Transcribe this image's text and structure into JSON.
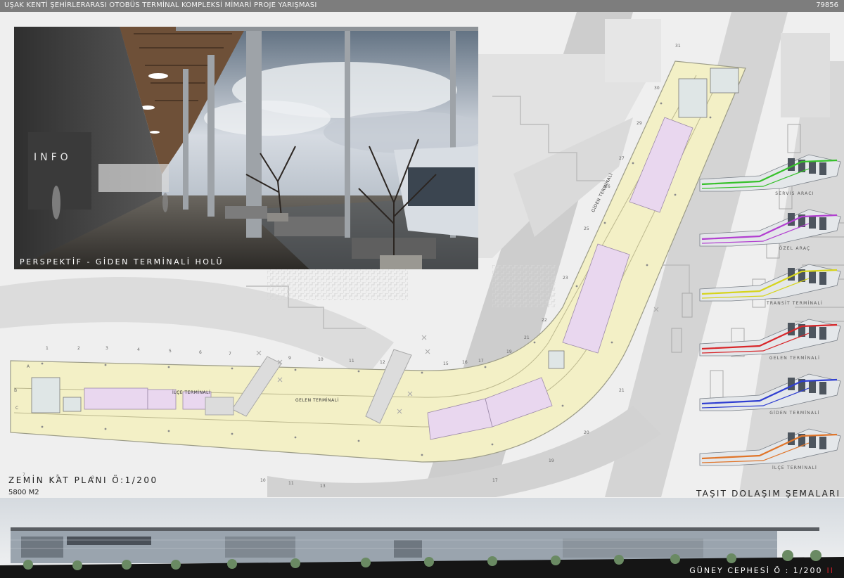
{
  "header": {
    "title": "UŞAK KENTİ ŞEHİRLERARASI OTOBÜS TERMİNAL KOMPLEKSİ MİMARİ PROJE YARIŞMASI",
    "number": "79856"
  },
  "perspective": {
    "caption": "PERSPEKTİF - GİDEN TERMİNALİ HOLÜ",
    "sign": "INFO"
  },
  "plan": {
    "title": "ZEMİN KAT PLANI Ö:1/200",
    "area": "5800 M2",
    "zones": {
      "ilce": "İLÇE TERMİNALİ",
      "gelen": "GELEN TERMİNALİ",
      "giden": "GİDEN TERMİNALİ"
    }
  },
  "schemes": {
    "title": "TAŞIT DOLAŞIM ŞEMALARI",
    "items": [
      {
        "label": "SERVİS ARACI",
        "color": "#36c12b"
      },
      {
        "label": "ÖZEL ARAÇ",
        "color": "#b23fd0"
      },
      {
        "label": "TRANSİT TERMİNALİ",
        "color": "#d6d41c"
      },
      {
        "label": "GELEN TERMİNALİ",
        "color": "#d8262a"
      },
      {
        "label": "GİDEN TERMİNALİ",
        "color": "#2f3ed1"
      },
      {
        "label": "İLÇE TERMİNALİ",
        "color": "#e0752a"
      }
    ]
  },
  "elevation": {
    "caption": "GÜNEY CEPHESİ Ö : 1/200",
    "mark": "II"
  },
  "colors": {
    "concourse": "#f3f0c6",
    "commercial": "#e9d7ef",
    "road": "#cfcfcf"
  }
}
